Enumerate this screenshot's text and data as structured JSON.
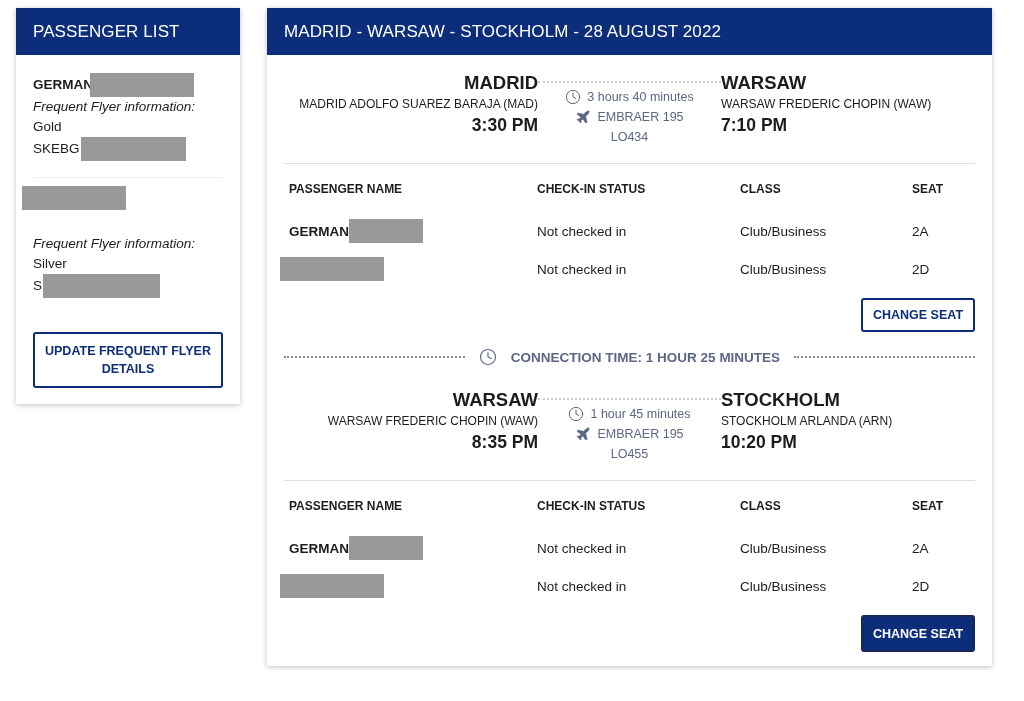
{
  "passenger_list": {
    "title": "PASSENGER LIST",
    "passengers": [
      {
        "name": "GERMAN",
        "name_redacted": true,
        "ff_label": "Frequent Flyer information:",
        "tier": "Gold",
        "number": "SKEBG",
        "number_redacted": true
      },
      {
        "name_redacted": true,
        "ff_label": "Frequent Flyer information:",
        "tier": "Silver",
        "number": "S",
        "number_redacted": true
      }
    ],
    "button": "UPDATE FREQUENT FLYER DETAILS"
  },
  "itinerary": {
    "title": "MADRID - WARSAW - STOCKHOLM - 28 AUGUST 2022",
    "items": [
      {
        "kind": "flight",
        "from_city": "MADRID",
        "from_airport": "MADRID ADOLFO SUAREZ BARAJA (MAD)",
        "from_time": "3:30 PM",
        "duration": "3 hours 40 minutes",
        "aircraft": "EMBRAER 195",
        "flight": "LO434",
        "to_city": "WARSAW",
        "to_airport": "WARSAW FREDERIC CHOPIN (WAW)",
        "to_time": "7:10 PM",
        "columns": [
          "PASSENGER NAME",
          "CHECK-IN STATUS",
          "CLASS",
          "SEAT"
        ],
        "rows": [
          {
            "name": "GERMAN",
            "redacted": true,
            "status": "Not checked in",
            "class": "Club/Business",
            "seat": "2A"
          },
          {
            "redacted": true,
            "status": "Not checked in",
            "class": "Club/Business",
            "seat": "2D"
          }
        ],
        "button": {
          "label": "CHANGE SEAT",
          "focused": false
        }
      },
      {
        "kind": "connection",
        "text": "CONNECTION TIME: 1 HOUR 25 MINUTES"
      },
      {
        "kind": "flight",
        "from_city": "WARSAW",
        "from_airport": "WARSAW FREDERIC CHOPIN (WAW)",
        "from_time": "8:35 PM",
        "duration": "1 hour 45 minutes",
        "aircraft": "EMBRAER 195",
        "flight": "LO455",
        "to_city": "STOCKHOLM",
        "to_airport": "STOCKHOLM ARLANDA (ARN)",
        "to_time": "10:20 PM",
        "columns": [
          "PASSENGER NAME",
          "CHECK-IN STATUS",
          "CLASS",
          "SEAT"
        ],
        "rows": [
          {
            "name": "GERMAN",
            "redacted": true,
            "status": "Not checked in",
            "class": "Club/Business",
            "seat": "2A"
          },
          {
            "redacted": true,
            "status": "Not checked in",
            "class": "Club/Business",
            "seat": "2D"
          }
        ],
        "button": {
          "label": "CHANGE SEAT",
          "focused": true
        }
      }
    ]
  }
}
